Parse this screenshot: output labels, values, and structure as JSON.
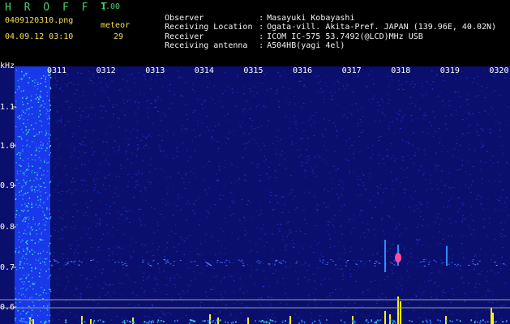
{
  "header": {
    "app_title": "H R O F F T",
    "version": "1.00",
    "file_name": "0409120310.png",
    "date_time": "04.09.12 03:10",
    "meteor_label": "meteor",
    "meteor_count": "29"
  },
  "station_info": [
    {
      "key": "Observer",
      "value": "Masayuki Kobayashi"
    },
    {
      "key": "Receiving Location",
      "value": "Ogata-vill. Akita-Pref. JAPAN (139.96E, 40.02N)"
    },
    {
      "key": "Receiver",
      "value": "ICOM IC-575 53.7492(@LCD)MHz USB"
    },
    {
      "key": "Receiving antenna",
      "value": "A504HB(yagi 4el)"
    }
  ],
  "spectrogram": {
    "unit_label": "kHz",
    "freq_ticks": [
      "1.1",
      "1.0",
      "0.9",
      "0.8",
      "0.7",
      "0.6"
    ],
    "time_ticks": [
      "0311",
      "0312",
      "0313",
      "0314",
      "0315",
      "0316",
      "0317",
      "0318",
      "0319",
      "0320"
    ],
    "colors": {
      "background": "#0a0f6e",
      "noise": "#2a52ff",
      "signal": "#ff4aa0",
      "bar": "#f6f20b",
      "axis_text": "#ffffff",
      "tick": "#f2e04a"
    }
  }
}
